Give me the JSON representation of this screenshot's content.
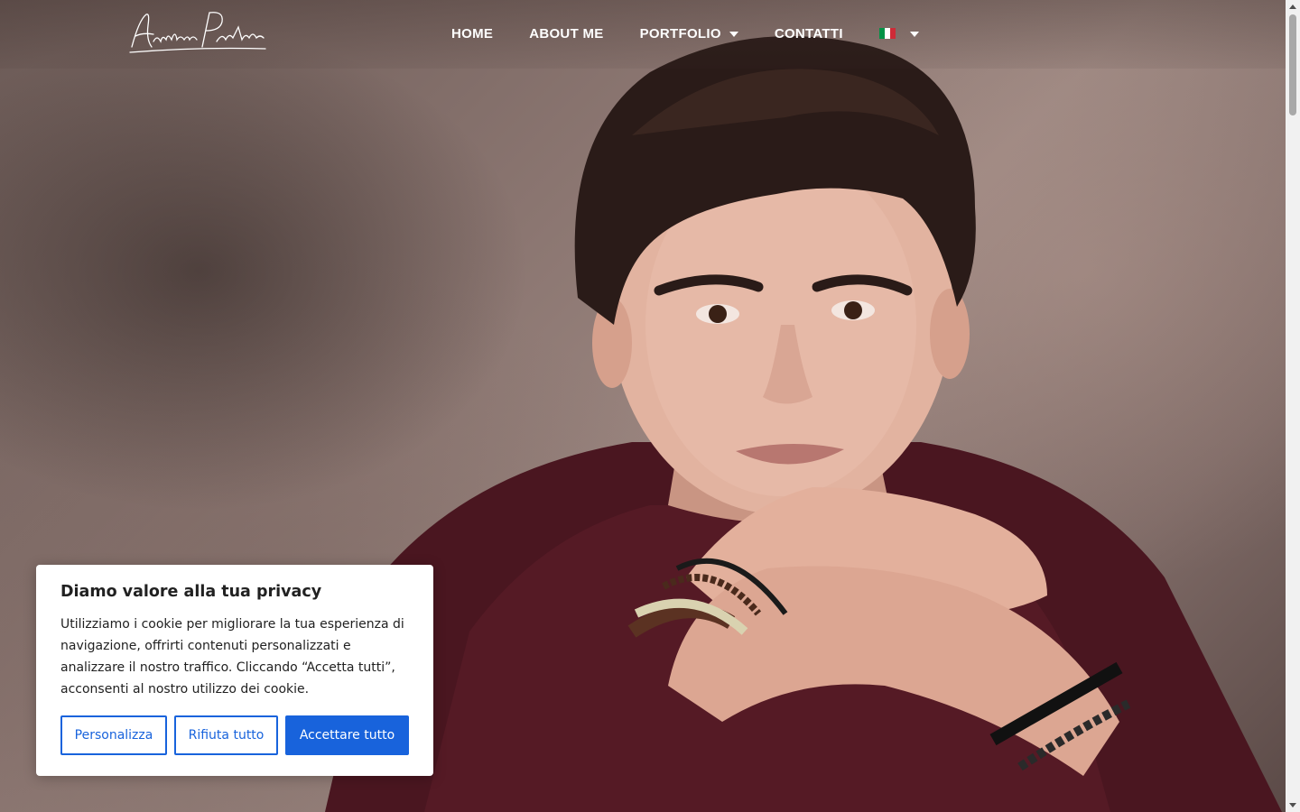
{
  "header": {
    "logo_text": "Andrea Pavan",
    "nav": [
      {
        "label": "HOME"
      },
      {
        "label": "ABOUT ME"
      },
      {
        "label": "PORTFOLIO",
        "has_dropdown": true
      },
      {
        "label": "CONTATTI"
      }
    ],
    "language": {
      "selected": "Italiano",
      "flag_colors": [
        "#009246",
        "#ffffff",
        "#ce2b37"
      ]
    }
  },
  "hero": {
    "image": "portrait of a young man with dark hair in a burgundy sweater, chin resting on crossed hands, wearing bracelets"
  },
  "cookie_banner": {
    "title": "Diamo valore alla tua privacy",
    "text": "Utilizziamo i cookie per migliorare la tua esperienza di navigazione, offrirti contenuti personalizzati e analizzare il nostro traffico. Cliccando “Accetta tutti”, acconsenti al nostro utilizzo dei cookie.",
    "buttons": {
      "customize": "Personalizza",
      "reject": "Rifiuta tutto",
      "accept": "Accettare tutto"
    },
    "accent_color": "#1863dc"
  }
}
